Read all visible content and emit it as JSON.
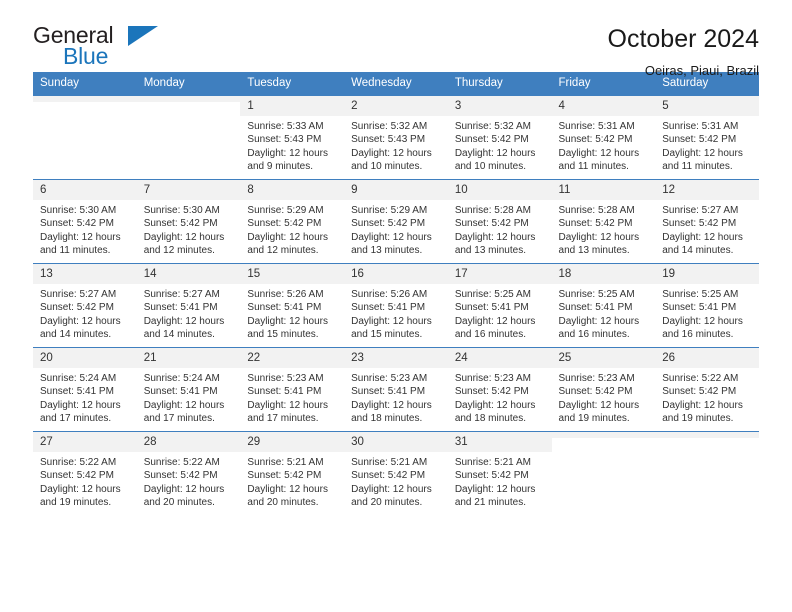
{
  "brand": {
    "line1": "General",
    "line2": "Blue",
    "triangle_icon": "blue-triangle-logo-mark",
    "accent_color": "#1b75bb"
  },
  "header": {
    "title": "October 2024",
    "subtitle": "Oeiras, Piaui, Brazil"
  },
  "colors": {
    "header_row": "#3f7fbf",
    "daynum_band": "#f2f2f2",
    "text": "#333333"
  },
  "calendar": {
    "weekday_headers": [
      "Sunday",
      "Monday",
      "Tuesday",
      "Wednesday",
      "Thursday",
      "Friday",
      "Saturday"
    ],
    "labels": {
      "sunrise": "Sunrise:",
      "sunset": "Sunset:",
      "daylight": "Daylight:"
    },
    "weeks": [
      [
        {
          "day": "",
          "empty": true
        },
        {
          "day": "",
          "empty": true
        },
        {
          "day": "1",
          "sunrise": "Sunrise: 5:33 AM",
          "sunset": "Sunset: 5:43 PM",
          "daylight_1": "Daylight: 12 hours",
          "daylight_2": "and 9 minutes."
        },
        {
          "day": "2",
          "sunrise": "Sunrise: 5:32 AM",
          "sunset": "Sunset: 5:43 PM",
          "daylight_1": "Daylight: 12 hours",
          "daylight_2": "and 10 minutes."
        },
        {
          "day": "3",
          "sunrise": "Sunrise: 5:32 AM",
          "sunset": "Sunset: 5:42 PM",
          "daylight_1": "Daylight: 12 hours",
          "daylight_2": "and 10 minutes."
        },
        {
          "day": "4",
          "sunrise": "Sunrise: 5:31 AM",
          "sunset": "Sunset: 5:42 PM",
          "daylight_1": "Daylight: 12 hours",
          "daylight_2": "and 11 minutes."
        },
        {
          "day": "5",
          "sunrise": "Sunrise: 5:31 AM",
          "sunset": "Sunset: 5:42 PM",
          "daylight_1": "Daylight: 12 hours",
          "daylight_2": "and 11 minutes."
        }
      ],
      [
        {
          "day": "6",
          "sunrise": "Sunrise: 5:30 AM",
          "sunset": "Sunset: 5:42 PM",
          "daylight_1": "Daylight: 12 hours",
          "daylight_2": "and 11 minutes."
        },
        {
          "day": "7",
          "sunrise": "Sunrise: 5:30 AM",
          "sunset": "Sunset: 5:42 PM",
          "daylight_1": "Daylight: 12 hours",
          "daylight_2": "and 12 minutes."
        },
        {
          "day": "8",
          "sunrise": "Sunrise: 5:29 AM",
          "sunset": "Sunset: 5:42 PM",
          "daylight_1": "Daylight: 12 hours",
          "daylight_2": "and 12 minutes."
        },
        {
          "day": "9",
          "sunrise": "Sunrise: 5:29 AM",
          "sunset": "Sunset: 5:42 PM",
          "daylight_1": "Daylight: 12 hours",
          "daylight_2": "and 13 minutes."
        },
        {
          "day": "10",
          "sunrise": "Sunrise: 5:28 AM",
          "sunset": "Sunset: 5:42 PM",
          "daylight_1": "Daylight: 12 hours",
          "daylight_2": "and 13 minutes."
        },
        {
          "day": "11",
          "sunrise": "Sunrise: 5:28 AM",
          "sunset": "Sunset: 5:42 PM",
          "daylight_1": "Daylight: 12 hours",
          "daylight_2": "and 13 minutes."
        },
        {
          "day": "12",
          "sunrise": "Sunrise: 5:27 AM",
          "sunset": "Sunset: 5:42 PM",
          "daylight_1": "Daylight: 12 hours",
          "daylight_2": "and 14 minutes."
        }
      ],
      [
        {
          "day": "13",
          "sunrise": "Sunrise: 5:27 AM",
          "sunset": "Sunset: 5:42 PM",
          "daylight_1": "Daylight: 12 hours",
          "daylight_2": "and 14 minutes."
        },
        {
          "day": "14",
          "sunrise": "Sunrise: 5:27 AM",
          "sunset": "Sunset: 5:41 PM",
          "daylight_1": "Daylight: 12 hours",
          "daylight_2": "and 14 minutes."
        },
        {
          "day": "15",
          "sunrise": "Sunrise: 5:26 AM",
          "sunset": "Sunset: 5:41 PM",
          "daylight_1": "Daylight: 12 hours",
          "daylight_2": "and 15 minutes."
        },
        {
          "day": "16",
          "sunrise": "Sunrise: 5:26 AM",
          "sunset": "Sunset: 5:41 PM",
          "daylight_1": "Daylight: 12 hours",
          "daylight_2": "and 15 minutes."
        },
        {
          "day": "17",
          "sunrise": "Sunrise: 5:25 AM",
          "sunset": "Sunset: 5:41 PM",
          "daylight_1": "Daylight: 12 hours",
          "daylight_2": "and 16 minutes."
        },
        {
          "day": "18",
          "sunrise": "Sunrise: 5:25 AM",
          "sunset": "Sunset: 5:41 PM",
          "daylight_1": "Daylight: 12 hours",
          "daylight_2": "and 16 minutes."
        },
        {
          "day": "19",
          "sunrise": "Sunrise: 5:25 AM",
          "sunset": "Sunset: 5:41 PM",
          "daylight_1": "Daylight: 12 hours",
          "daylight_2": "and 16 minutes."
        }
      ],
      [
        {
          "day": "20",
          "sunrise": "Sunrise: 5:24 AM",
          "sunset": "Sunset: 5:41 PM",
          "daylight_1": "Daylight: 12 hours",
          "daylight_2": "and 17 minutes."
        },
        {
          "day": "21",
          "sunrise": "Sunrise: 5:24 AM",
          "sunset": "Sunset: 5:41 PM",
          "daylight_1": "Daylight: 12 hours",
          "daylight_2": "and 17 minutes."
        },
        {
          "day": "22",
          "sunrise": "Sunrise: 5:23 AM",
          "sunset": "Sunset: 5:41 PM",
          "daylight_1": "Daylight: 12 hours",
          "daylight_2": "and 17 minutes."
        },
        {
          "day": "23",
          "sunrise": "Sunrise: 5:23 AM",
          "sunset": "Sunset: 5:41 PM",
          "daylight_1": "Daylight: 12 hours",
          "daylight_2": "and 18 minutes."
        },
        {
          "day": "24",
          "sunrise": "Sunrise: 5:23 AM",
          "sunset": "Sunset: 5:42 PM",
          "daylight_1": "Daylight: 12 hours",
          "daylight_2": "and 18 minutes."
        },
        {
          "day": "25",
          "sunrise": "Sunrise: 5:23 AM",
          "sunset": "Sunset: 5:42 PM",
          "daylight_1": "Daylight: 12 hours",
          "daylight_2": "and 19 minutes."
        },
        {
          "day": "26",
          "sunrise": "Sunrise: 5:22 AM",
          "sunset": "Sunset: 5:42 PM",
          "daylight_1": "Daylight: 12 hours",
          "daylight_2": "and 19 minutes."
        }
      ],
      [
        {
          "day": "27",
          "sunrise": "Sunrise: 5:22 AM",
          "sunset": "Sunset: 5:42 PM",
          "daylight_1": "Daylight: 12 hours",
          "daylight_2": "and 19 minutes."
        },
        {
          "day": "28",
          "sunrise": "Sunrise: 5:22 AM",
          "sunset": "Sunset: 5:42 PM",
          "daylight_1": "Daylight: 12 hours",
          "daylight_2": "and 20 minutes."
        },
        {
          "day": "29",
          "sunrise": "Sunrise: 5:21 AM",
          "sunset": "Sunset: 5:42 PM",
          "daylight_1": "Daylight: 12 hours",
          "daylight_2": "and 20 minutes."
        },
        {
          "day": "30",
          "sunrise": "Sunrise: 5:21 AM",
          "sunset": "Sunset: 5:42 PM",
          "daylight_1": "Daylight: 12 hours",
          "daylight_2": "and 20 minutes."
        },
        {
          "day": "31",
          "sunrise": "Sunrise: 5:21 AM",
          "sunset": "Sunset: 5:42 PM",
          "daylight_1": "Daylight: 12 hours",
          "daylight_2": "and 21 minutes."
        },
        {
          "day": "",
          "empty": true
        },
        {
          "day": "",
          "empty": true
        }
      ]
    ]
  }
}
